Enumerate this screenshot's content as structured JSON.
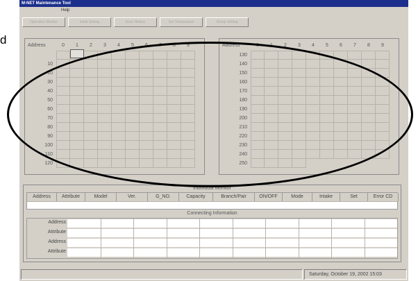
{
  "window": {
    "title": "M-NET Maintenance Tool",
    "menu_help": "Help"
  },
  "toolbar": [
    "Operation Monitor",
    "Initial Setting",
    "Error History",
    "Set Temperature",
    "Group Setting"
  ],
  "side_text": "d",
  "left_grid": {
    "title": "Address",
    "columns": [
      "0",
      "1",
      "2",
      "3",
      "4",
      "5",
      "6",
      "7",
      "8",
      "9"
    ],
    "rows": [
      "",
      "10",
      "20",
      "30",
      "40",
      "50",
      "60",
      "70",
      "80",
      "90",
      "100",
      "110",
      "120"
    ]
  },
  "right_grid": {
    "title": "Address",
    "columns": [
      "0",
      "1",
      "2",
      "3",
      "4",
      "5",
      "6",
      "7",
      "8",
      "9"
    ],
    "rows": [
      "130",
      "140",
      "150",
      "160",
      "170",
      "180",
      "190",
      "200",
      "210",
      "220",
      "230",
      "240",
      "250"
    ]
  },
  "monitor": {
    "title": "Individual Monitor",
    "columns": [
      "Address",
      "Attribute",
      "Model",
      "Ver.",
      "G_NO.",
      "Capacity",
      "Branch/Pair",
      "ON/OFF",
      "Mode",
      "Intake",
      "Set",
      "Error CD"
    ]
  },
  "connecting": {
    "title": "Connecting Information",
    "row_labels": [
      "Address",
      "Attribute",
      "Address",
      "Attribute"
    ]
  },
  "status": {
    "datetime": "Saturday, October 19, 2002 15:03"
  }
}
